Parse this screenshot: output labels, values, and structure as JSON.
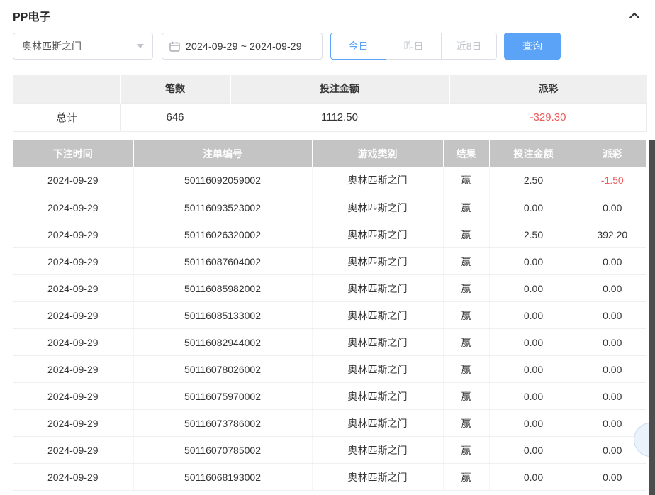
{
  "panel": {
    "title": "PP电子"
  },
  "filters": {
    "game_select": {
      "value": "奥林匹斯之门"
    },
    "date_range": {
      "value": "2024-09-29 ~ 2024-09-29"
    },
    "quick_buttons": [
      {
        "label": "今日",
        "active": true
      },
      {
        "label": "昨日",
        "active": false
      },
      {
        "label": "近8日",
        "active": false
      }
    ],
    "search_button": "查询"
  },
  "summary": {
    "headers": [
      "",
      "笔数",
      "投注金额",
      "派彩"
    ],
    "total_label": "总计",
    "count": "646",
    "bet_amount": "1112.50",
    "payout": "-329.30"
  },
  "table": {
    "headers": [
      "下注时间",
      "注单编号",
      "游戏类别",
      "结果",
      "投注金额",
      "派彩"
    ],
    "rows": [
      {
        "date": "2024-09-29",
        "order_no": "50116092059002",
        "game": "奥林匹斯之门",
        "result": "赢",
        "bet": "2.50",
        "payout": "-1.50",
        "payout_red": true
      },
      {
        "date": "2024-09-29",
        "order_no": "50116093523002",
        "game": "奥林匹斯之门",
        "result": "赢",
        "bet": "0.00",
        "payout": "0.00",
        "payout_red": false
      },
      {
        "date": "2024-09-29",
        "order_no": "50116026320002",
        "game": "奥林匹斯之门",
        "result": "赢",
        "bet": "2.50",
        "payout": "392.20",
        "payout_red": false
      },
      {
        "date": "2024-09-29",
        "order_no": "50116087604002",
        "game": "奥林匹斯之门",
        "result": "赢",
        "bet": "0.00",
        "payout": "0.00",
        "payout_red": false
      },
      {
        "date": "2024-09-29",
        "order_no": "50116085982002",
        "game": "奥林匹斯之门",
        "result": "赢",
        "bet": "0.00",
        "payout": "0.00",
        "payout_red": false
      },
      {
        "date": "2024-09-29",
        "order_no": "50116085133002",
        "game": "奥林匹斯之门",
        "result": "赢",
        "bet": "0.00",
        "payout": "0.00",
        "payout_red": false
      },
      {
        "date": "2024-09-29",
        "order_no": "50116082944002",
        "game": "奥林匹斯之门",
        "result": "赢",
        "bet": "0.00",
        "payout": "0.00",
        "payout_red": false
      },
      {
        "date": "2024-09-29",
        "order_no": "50116078026002",
        "game": "奥林匹斯之门",
        "result": "赢",
        "bet": "0.00",
        "payout": "0.00",
        "payout_red": false
      },
      {
        "date": "2024-09-29",
        "order_no": "50116075970002",
        "game": "奥林匹斯之门",
        "result": "赢",
        "bet": "0.00",
        "payout": "0.00",
        "payout_red": false
      },
      {
        "date": "2024-09-29",
        "order_no": "50116073786002",
        "game": "奥林匹斯之门",
        "result": "赢",
        "bet": "0.00",
        "payout": "0.00",
        "payout_red": false
      },
      {
        "date": "2024-09-29",
        "order_no": "50116070785002",
        "game": "奥林匹斯之门",
        "result": "赢",
        "bet": "0.00",
        "payout": "0.00",
        "payout_red": false
      },
      {
        "date": "2024-09-29",
        "order_no": "50116068193002",
        "game": "奥林匹斯之门",
        "result": "赢",
        "bet": "0.00",
        "payout": "0.00",
        "payout_red": false
      }
    ]
  },
  "colors": {
    "accent_blue": "#5ba3f7",
    "negative_red": "#ee5b5b",
    "table_header_bg": "#c4c4c4",
    "summary_header_bg": "#efefef"
  }
}
